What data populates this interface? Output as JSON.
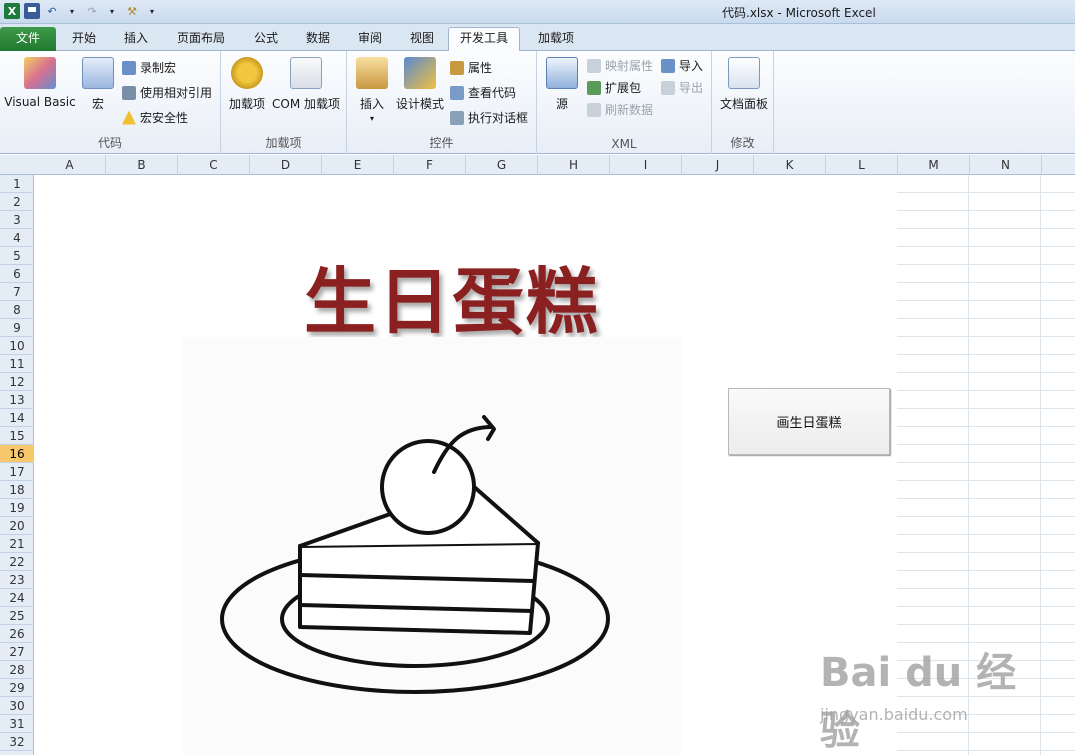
{
  "window": {
    "title": "代码.xlsx  -  Microsoft Excel"
  },
  "tabs": [
    "文件",
    "开始",
    "插入",
    "页面布局",
    "公式",
    "数据",
    "审阅",
    "视图",
    "开发工具",
    "加载项"
  ],
  "ribbon": {
    "code_group": {
      "label": "代码",
      "visual_basic": "Visual Basic",
      "macro": "宏",
      "record_macro": "录制宏",
      "relative_ref": "使用相对引用",
      "macro_security": "宏安全性"
    },
    "addins_group": {
      "label": "加载项",
      "addins": "加载项",
      "com_addins": "COM 加载项"
    },
    "controls_group": {
      "label": "控件",
      "insert": "插入",
      "design_mode": "设计模式",
      "properties": "属性",
      "view_code": "查看代码",
      "run_dialog": "执行对话框"
    },
    "xml_group": {
      "label": "XML",
      "source": "源",
      "map_properties": "映射属性",
      "expansion_packs": "扩展包",
      "refresh_data": "刷新数据",
      "import": "导入",
      "export": "导出"
    },
    "modify_group": {
      "label": "修改",
      "document_panel": "文档面板"
    }
  },
  "columns": [
    "A",
    "B",
    "C",
    "D",
    "E",
    "F",
    "G",
    "H",
    "I",
    "J",
    "K",
    "L",
    "M",
    "N"
  ],
  "rows": [
    "1",
    "2",
    "3",
    "4",
    "5",
    "6",
    "7",
    "8",
    "9",
    "10",
    "11",
    "12",
    "13",
    "14",
    "15",
    "16",
    "17",
    "18",
    "19",
    "20",
    "21",
    "22",
    "23",
    "24",
    "25",
    "26",
    "27",
    "28",
    "29",
    "30",
    "31",
    "32"
  ],
  "selected_row": "16",
  "sheet": {
    "title_art": "生日蛋糕",
    "button_label": "画生日蛋糕"
  },
  "watermark": {
    "brand": "Bai du 经验",
    "url": "jingyan.baidu.com"
  },
  "colors": {
    "file_tab": "#2a8a3a",
    "title_art": "#8b2020",
    "selected_row": "#f7c86b"
  }
}
